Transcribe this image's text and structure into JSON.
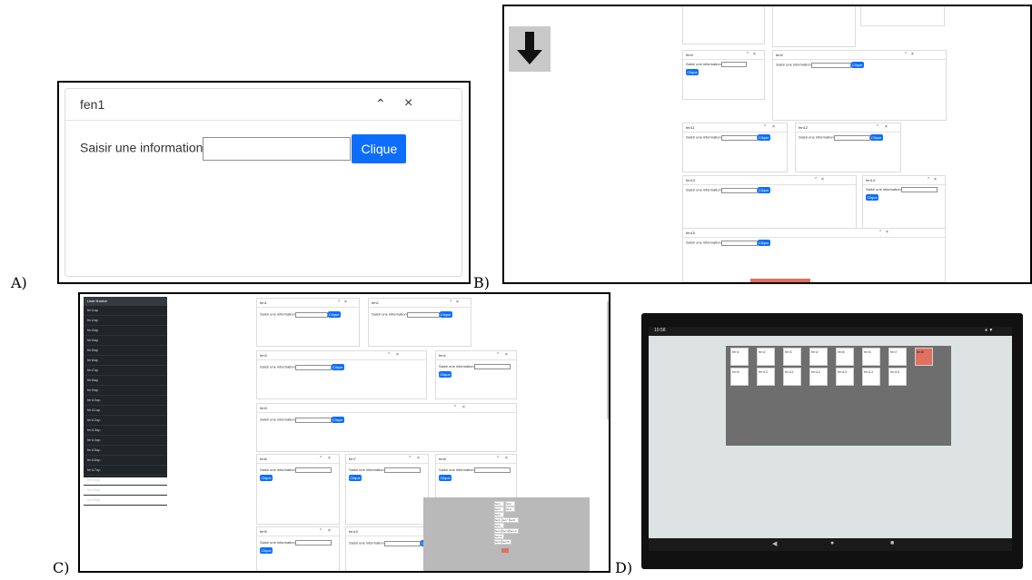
{
  "figure": {
    "labels": [
      "A)",
      "B)",
      "C)",
      "D)"
    ]
  },
  "window_text": {
    "input_label": "Saisir une information",
    "button_label": "Clique"
  },
  "panel_a": {
    "window": {
      "title": "fen1",
      "minimize_icon": "chevron-up-icon",
      "close_icon": "close-icon"
    }
  },
  "panel_b": {
    "scroll_indicator_icon": "arrow-down-icon",
    "windows": [
      {
        "title": "fen9"
      },
      {
        "title": "fen9"
      },
      {
        "title": "fen11"
      },
      {
        "title": "fen12"
      },
      {
        "title": "fen13"
      },
      {
        "title": "fen14"
      },
      {
        "title": "fen15"
      }
    ]
  },
  "panel_c": {
    "sidebar_title": "Liste fenetre",
    "sidebar_items": [
      "fen1ap",
      "fen2ap",
      "fen3ap",
      "fen4ap",
      "fen5ap",
      "fen6ap",
      "fen7ap",
      "fen8ap",
      "fen9ap",
      "fen10ap",
      "fen11ap",
      "fen12ap",
      "fen13ap",
      "fen14ap",
      "fen15ap",
      "fen16ap",
      "fen17ap",
      "fen18ap",
      "fen19ap",
      "fen20ap"
    ],
    "windows": [
      {
        "title": "fen1"
      },
      {
        "title": "fen2"
      },
      {
        "title": "fen3"
      },
      {
        "title": "fen4"
      },
      {
        "title": "fen5"
      },
      {
        "title": "fen6"
      },
      {
        "title": "fen7"
      },
      {
        "title": "fen8"
      },
      {
        "title": "fen9"
      },
      {
        "title": "fen10"
      }
    ],
    "minimap_labels": [
      "fen1",
      "fen2",
      "fen3",
      "fen4",
      "fen5",
      "fen6",
      "fen7",
      "fen8",
      "fen9",
      "fen10",
      "fen11",
      "fen12",
      "fen13",
      "fen14",
      "fen15"
    ]
  },
  "panel_d": {
    "status_time": "10:58",
    "row1": [
      "fen1",
      "fen2",
      "fen3",
      "fen4",
      "fen5",
      "fen6",
      "fen7",
      "fen8"
    ],
    "row2": [
      "fen9",
      "fen10",
      "fen11",
      "fen12",
      "fen13",
      "fen14",
      "fen15"
    ],
    "nav_icons": [
      "back-icon",
      "home-icon",
      "recents-icon"
    ],
    "colors": {
      "highlight": "#e07060",
      "canvas": "#6e6e6e",
      "screen": "#dde3e2",
      "bezel": "#111111"
    }
  }
}
